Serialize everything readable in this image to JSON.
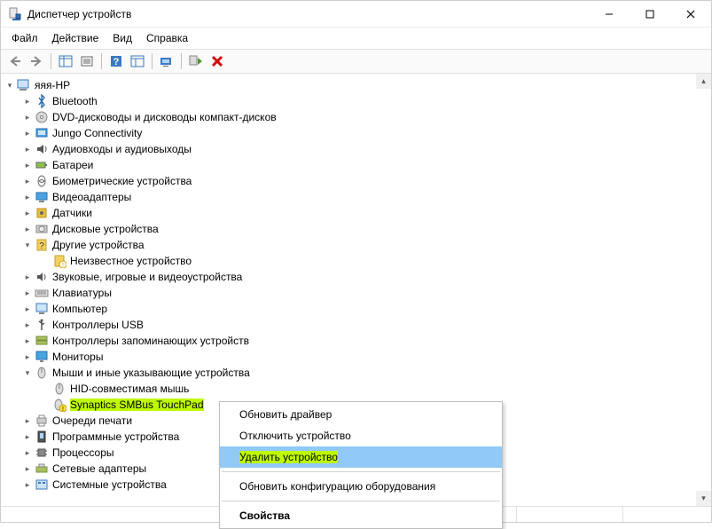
{
  "window": {
    "title": "Диспетчер устройств"
  },
  "menu": {
    "file": "Файл",
    "action": "Действие",
    "view": "Вид",
    "help": "Справка"
  },
  "root": {
    "label": "яяя-HP"
  },
  "nodes": {
    "n0": {
      "label": "Bluetooth"
    },
    "n1": {
      "label": "DVD-дисководы и дисководы компакт-дисков"
    },
    "n2": {
      "label": "Jungo Connectivity"
    },
    "n3": {
      "label": "Аудиовходы и аудиовыходы"
    },
    "n4": {
      "label": "Батареи"
    },
    "n5": {
      "label": "Биометрические устройства"
    },
    "n6": {
      "label": "Видеоадаптеры"
    },
    "n7": {
      "label": "Датчики"
    },
    "n8": {
      "label": "Дисковые устройства"
    },
    "n9": {
      "label": "Другие устройства"
    },
    "n9a": {
      "label": "Неизвестное устройство"
    },
    "n10": {
      "label": "Звуковые, игровые и видеоустройства"
    },
    "n11": {
      "label": "Клавиатуры"
    },
    "n12": {
      "label": "Компьютер"
    },
    "n13": {
      "label": "Контроллеры USB"
    },
    "n14": {
      "label": "Контроллеры запоминающих устройств"
    },
    "n15": {
      "label": "Мониторы"
    },
    "n16": {
      "label": "Мыши и иные указывающие устройства"
    },
    "n16a": {
      "label": "HID-совместимая мышь"
    },
    "n16b": {
      "label": "Synaptics SMBus TouchPad"
    },
    "n17": {
      "label": "Очереди печати"
    },
    "n18": {
      "label": "Программные устройства"
    },
    "n19": {
      "label": "Процессоры"
    },
    "n20": {
      "label": "Сетевые адаптеры"
    },
    "n21": {
      "label": "Системные устройства"
    }
  },
  "ctx": {
    "update_driver": "Обновить драйвер",
    "disable_device": "Отключить устройство",
    "remove_device": "Удалить устройство",
    "refresh_hw": "Обновить конфигурацию оборудования",
    "properties": "Свойства"
  }
}
